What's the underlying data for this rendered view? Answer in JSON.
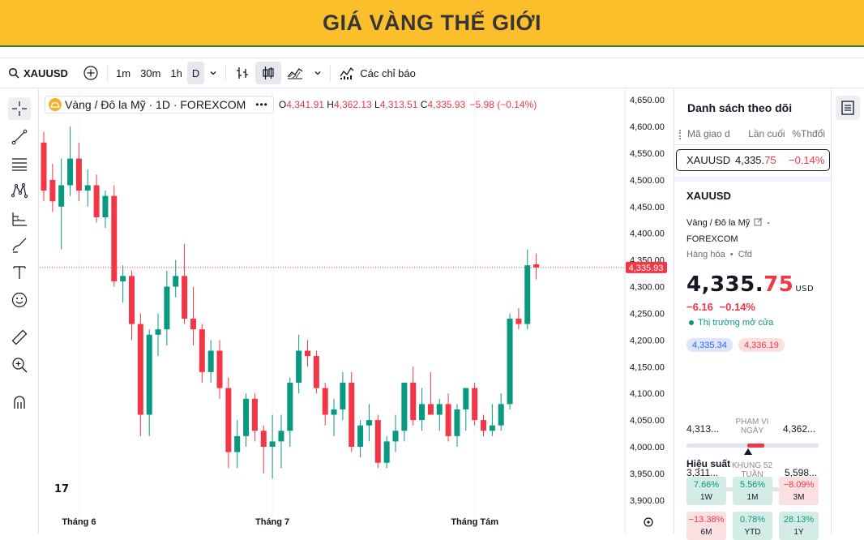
{
  "banner": {
    "title": "GIÁ VÀNG THẾ GIỚI"
  },
  "toolbar": {
    "symbol": "XAUUSD",
    "intervals": [
      "1m",
      "30m",
      "1h",
      "D"
    ],
    "indicators_label": "Các chỉ báo",
    "icons": [
      "search-icon",
      "add-symbol-icon",
      "chevron-down-icon",
      "bar-style-icon",
      "candle-style-icon",
      "area-style-icon",
      "indicators-icon"
    ]
  },
  "left_tools": [
    "crosshair-icon",
    "trend-line-icon",
    "fib-icon",
    "pattern-icon",
    "forecast-icon",
    "brush-icon",
    "text-icon",
    "emoji-icon",
    "ruler-icon",
    "zoom-in-icon",
    "magnet-icon"
  ],
  "legend": {
    "title": "Vàng / Đô la Mỹ · 1D · FOREXCOM",
    "more": "•••",
    "o_label": "O",
    "o": "4,341.91",
    "h_label": "H",
    "h": "4,362.13",
    "l_label": "L",
    "l": "4,313.51",
    "c_label": "C",
    "c": "4,335.93",
    "change": "−5.98 (−0.14%)"
  },
  "chart_data": {
    "type": "candlestick",
    "title": "Vàng / Đô la Mỹ · 1D · FOREXCOM",
    "x_labels": [
      "Tháng 6",
      "Tháng 7",
      "Tháng Tám"
    ],
    "y_ticks": [
      "4,650.00",
      "4,600.00",
      "4,550.00",
      "4,500.00",
      "4,450.00",
      "4,400.00",
      "4,350.00",
      "4,300.00",
      "4,250.00",
      "4,200.00",
      "4,150.00",
      "4,100.00",
      "4,050.00",
      "4,000.00",
      "3,950.00",
      "3,900.00"
    ],
    "ylim": [
      3880,
      4670
    ],
    "last_price": "4,335.93",
    "candles": [
      [
        4570,
        4590,
        4460,
        4480
      ],
      [
        4500,
        4530,
        4440,
        4460
      ],
      [
        4450,
        4540,
        4370,
        4490
      ],
      [
        4490,
        4600,
        4470,
        4540
      ],
      [
        4540,
        4570,
        4460,
        4480
      ],
      [
        4480,
        4520,
        4450,
        4490
      ],
      [
        4490,
        4510,
        4420,
        4430
      ],
      [
        4430,
        4480,
        4410,
        4470
      ],
      [
        4470,
        4490,
        4300,
        4310
      ],
      [
        4310,
        4340,
        4270,
        4320
      ],
      [
        4320,
        4330,
        4200,
        4230
      ],
      [
        4230,
        4250,
        4020,
        4060
      ],
      [
        4060,
        4220,
        4020,
        4210
      ],
      [
        4210,
        4250,
        4170,
        4220
      ],
      [
        4220,
        4330,
        4190,
        4300
      ],
      [
        4300,
        4350,
        4280,
        4320
      ],
      [
        4320,
        4380,
        4230,
        4240
      ],
      [
        4240,
        4300,
        4190,
        4220
      ],
      [
        4220,
        4230,
        4120,
        4140
      ],
      [
        4140,
        4200,
        4120,
        4180
      ],
      [
        4180,
        4200,
        4090,
        4110
      ],
      [
        4110,
        4130,
        3960,
        3990
      ],
      [
        3990,
        4050,
        3960,
        4020
      ],
      [
        4020,
        4100,
        4000,
        4090
      ],
      [
        4090,
        4100,
        4010,
        4030
      ],
      [
        4030,
        4040,
        3950,
        4000
      ],
      [
        4000,
        4060,
        3940,
        4010
      ],
      [
        4010,
        4060,
        3960,
        4030
      ],
      [
        4030,
        4130,
        4000,
        4120
      ],
      [
        4120,
        4210,
        4100,
        4180
      ],
      [
        4180,
        4200,
        4150,
        4170
      ],
      [
        4170,
        4180,
        4100,
        4110
      ],
      [
        4110,
        4120,
        4040,
        4060
      ],
      [
        4060,
        4090,
        4020,
        4070
      ],
      [
        4070,
        4140,
        4050,
        4120
      ],
      [
        4120,
        4140,
        3990,
        4000
      ],
      [
        4000,
        4050,
        3980,
        4040
      ],
      [
        4040,
        4080,
        4010,
        4050
      ],
      [
        4050,
        4060,
        3960,
        3970
      ],
      [
        3970,
        4020,
        3960,
        4010
      ],
      [
        4010,
        4060,
        3990,
        4030
      ],
      [
        4030,
        4090,
        4010,
        4120
      ],
      [
        4120,
        4150,
        4040,
        4050
      ],
      [
        4050,
        4110,
        4030,
        4080
      ],
      [
        4080,
        4140,
        4060,
        4060
      ],
      [
        4060,
        4090,
        4030,
        4080
      ],
      [
        4080,
        4100,
        4010,
        4020
      ],
      [
        4020,
        4080,
        4000,
        4070
      ],
      [
        4070,
        4110,
        4030,
        4110
      ],
      [
        4110,
        4120,
        4040,
        4050
      ],
      [
        4050,
        4060,
        4020,
        4030
      ],
      [
        4030,
        4080,
        4020,
        4040
      ],
      [
        4040,
        4100,
        4030,
        4080
      ],
      [
        4080,
        4250,
        4070,
        4240
      ],
      [
        4240,
        4260,
        4220,
        4230
      ],
      [
        4230,
        4370,
        4220,
        4340
      ],
      [
        4341.91,
        4362.13,
        4313.51,
        4335.93
      ]
    ]
  },
  "watchlist": {
    "title": "Danh sách theo dõi",
    "columns": [
      "Mã giao d",
      "Lần cuối",
      "%Thđổi"
    ],
    "rows": [
      {
        "symbol": "XAUUSD",
        "last_main": "4,335.",
        "last_tail": "75",
        "change": "−0.14%"
      }
    ]
  },
  "detail": {
    "symbol": "XAUUSD",
    "desc_1": "Vàng / Đô la Mỹ",
    "desc_2": "- ",
    "desc_3": "FOREXCOM",
    "type": "Hàng hóa",
    "type_sep": "•",
    "type_2": "Cfd",
    "price_main": "4,335.",
    "price_tail": "75",
    "unit": "USD",
    "change": "−6.16",
    "change_pct": "−0.14%",
    "market_status": "Thị trường mở cửa",
    "bid": "4,335.34",
    "ask": "4,336.19",
    "day_range_label": "PHẠM VI NGÀY",
    "day_low": "4,313...",
    "day_high": "4,362...",
    "week52_label": "KHUNG 52 TUẦN",
    "week52_low": "3,311...",
    "week52_high": "5,598...",
    "perf_title": "Hiệu suất",
    "perf": [
      {
        "value": "7.66%",
        "period": "1W",
        "dir": "up"
      },
      {
        "value": "5.56%",
        "period": "1M",
        "dir": "up"
      },
      {
        "value": "−8.09%",
        "period": "3M",
        "dir": "dn"
      },
      {
        "value": "−13.38%",
        "period": "6M",
        "dir": "dn"
      },
      {
        "value": "0.78%",
        "period": "YTD",
        "dir": "up"
      },
      {
        "value": "28.13%",
        "period": "1Y",
        "dir": "up"
      }
    ]
  },
  "colors": {
    "banner": "#fbbf2c",
    "up": "#089981",
    "down": "#f23645"
  }
}
